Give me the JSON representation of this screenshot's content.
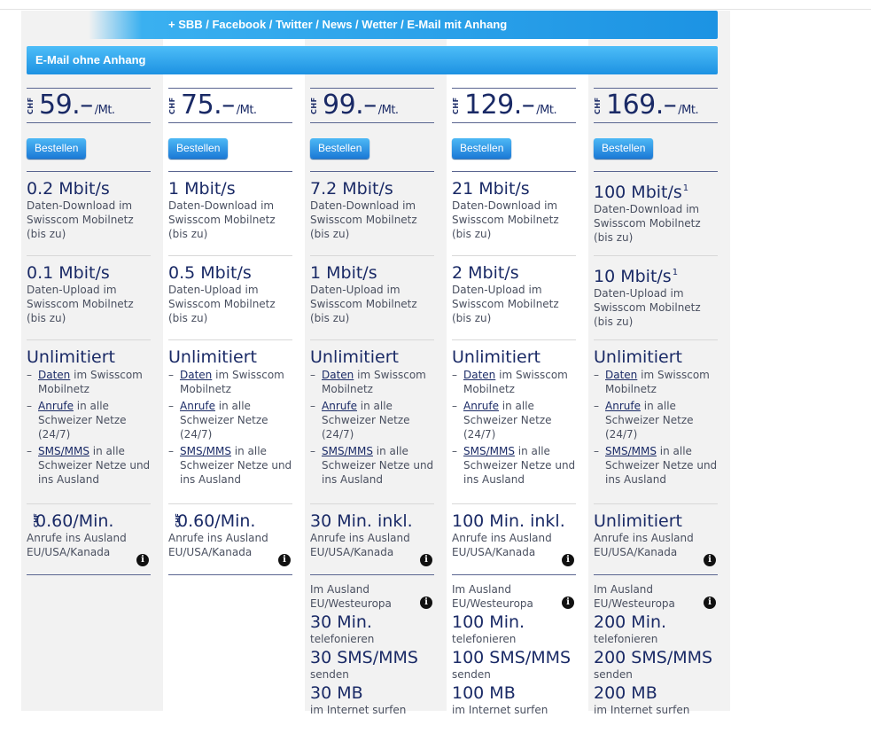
{
  "banners": {
    "top": "+ SBB / Facebook / Twitter / News / Wetter / E-Mail mit Anhang",
    "second": "E-Mail ohne Anhang"
  },
  "colors": {
    "accent": "#1c93e3",
    "text": "#1a2a66",
    "column_bg": "#f2f2f2"
  },
  "currency": "CHF",
  "order_label": "Bestellen",
  "unit": "/Mt.",
  "download_desc": [
    "Daten-Download im",
    "Swisscom Mobilnetz",
    "(bis zu)"
  ],
  "upload_desc": [
    "Daten-Upload im",
    "Swisscom Mobilnetz",
    "(bis zu)"
  ],
  "unlimited": {
    "title": "Unlimitiert",
    "items": [
      {
        "link": "Daten",
        "text": " im Swisscom Mobilnetz"
      },
      {
        "link": "Anrufe",
        "text": " in alle Schweizer Netze (24/7)"
      },
      {
        "link": "SMS/MMS",
        "text": " in alle Schweizer Netze und ins Ausland"
      }
    ]
  },
  "intl_desc": [
    "Anrufe ins Ausland",
    "EU/USA/Kanada"
  ],
  "abroad_desc": [
    "Im Ausland",
    "EU/Westeuropa"
  ],
  "abroad_labels": {
    "calls": "telefonieren",
    "sms": "senden",
    "data": "im Internet surfen"
  },
  "plans": [
    {
      "price": "59.–",
      "download": "0.2 Mbit/s",
      "download_sup": "",
      "upload": "0.1 Mbit/s",
      "upload_sup": "",
      "intl": "0.60/Min.",
      "intl_chf": true,
      "abroad": null
    },
    {
      "price": "75.–",
      "download": "1 Mbit/s",
      "download_sup": "",
      "upload": "0.5 Mbit/s",
      "upload_sup": "",
      "intl": "0.60/Min.",
      "intl_chf": true,
      "abroad": null
    },
    {
      "price": "99.–",
      "download": "7.2 Mbit/s",
      "download_sup": "",
      "upload": "1 Mbit/s",
      "upload_sup": "",
      "intl": "30 Min. inkl.",
      "intl_chf": false,
      "abroad": {
        "calls": "30 Min.",
        "sms": "30 SMS/MMS",
        "data": "30 MB"
      }
    },
    {
      "price": "129.–",
      "download": "21 Mbit/s",
      "download_sup": "",
      "upload": "2 Mbit/s",
      "upload_sup": "",
      "intl": "100 Min. inkl.",
      "intl_chf": false,
      "abroad": {
        "calls": "100 Min.",
        "sms": "100 SMS/MMS",
        "data": "100 MB"
      }
    },
    {
      "price": "169.–",
      "download": "100 Mbit/s",
      "download_sup": "1",
      "upload": "10 Mbit/s",
      "upload_sup": "1",
      "intl": "Unlimitiert",
      "intl_chf": false,
      "abroad": {
        "calls": "200 Min.",
        "sms": "200 SMS/MMS",
        "data": "200 MB"
      }
    }
  ]
}
